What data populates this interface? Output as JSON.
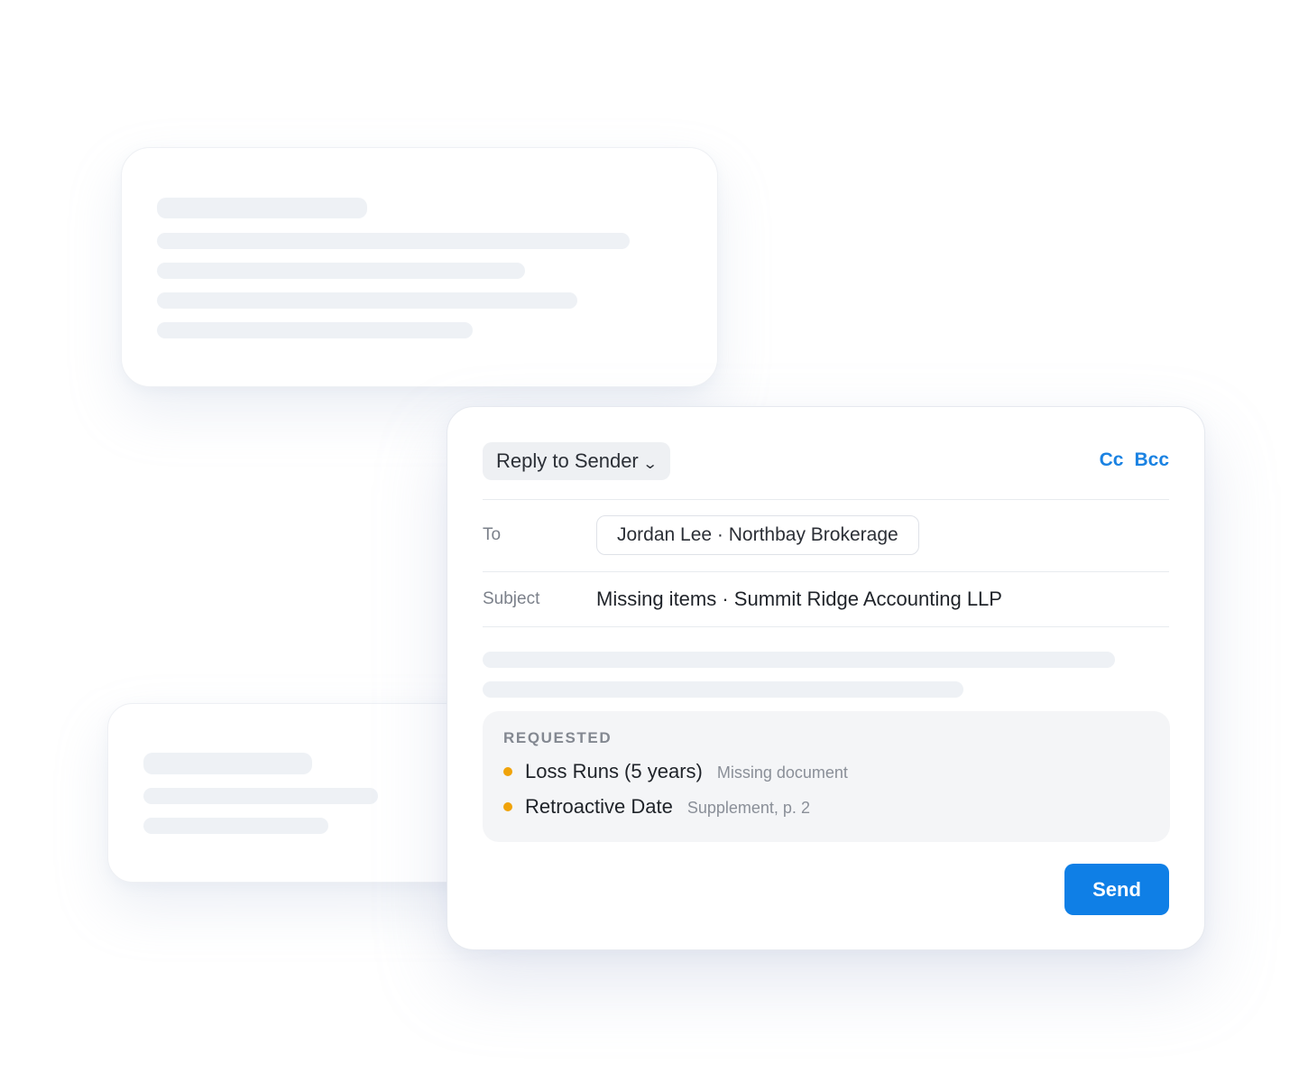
{
  "composer": {
    "reply_mode_label": "Reply to Sender",
    "reply_mode_chevron": "⌄",
    "cc_label": "Cc",
    "bcc_label": "Bcc",
    "to_label": "To",
    "to_recipient": "Jordan Lee · Northbay Brokerage",
    "subject_label": "Subject",
    "subject_value": "Missing items · Summit Ridge Accounting LLP",
    "requested": {
      "title": "REQUESTED",
      "items": [
        {
          "name": "Loss Runs (5 years)",
          "note": "Missing document"
        },
        {
          "name": "Retroactive Date",
          "note": "Supplement, p. 2"
        }
      ]
    },
    "send_label": "Send"
  },
  "colors": {
    "accent": "#0f7fe6",
    "link": "#1a82e2",
    "bullet": "#f0a30a",
    "skeleton": "#eef1f5"
  }
}
